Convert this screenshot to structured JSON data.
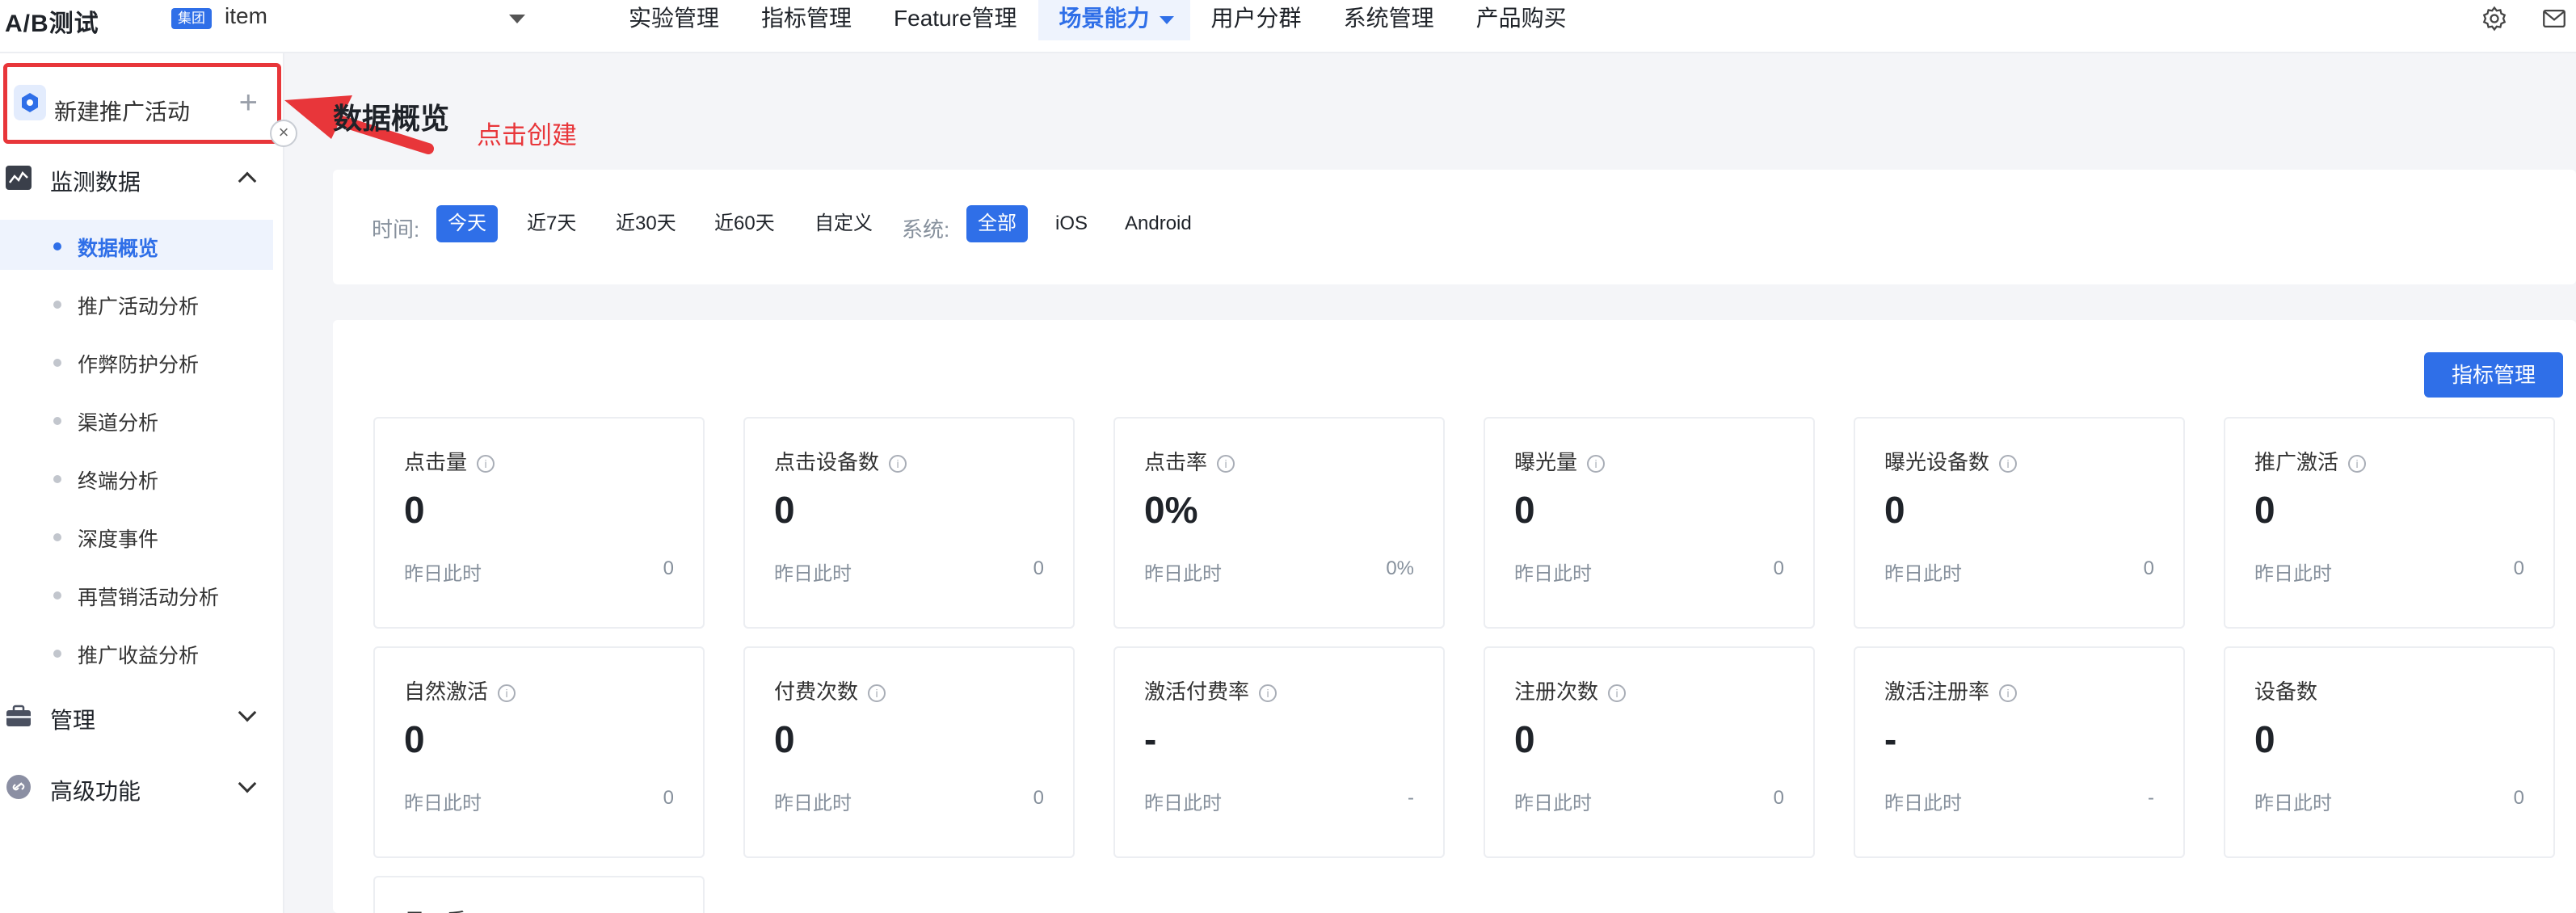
{
  "header": {
    "logo": "A/B测试",
    "badge": "集团",
    "app_name": "item",
    "nav": [
      "实验管理",
      "指标管理",
      "Feature管理",
      "场景能力",
      "用户分群",
      "系统管理",
      "产品购买"
    ],
    "active_nav": "场景能力"
  },
  "sidebar": {
    "new_activity": "新建推广活动",
    "collapse_glyph": "×",
    "groups": [
      {
        "label": "监测数据",
        "expanded": true
      },
      {
        "label": "管理",
        "expanded": false
      },
      {
        "label": "高级功能",
        "expanded": false
      }
    ],
    "sub_items": [
      "数据概览",
      "推广活动分析",
      "作弊防护分析",
      "渠道分析",
      "终端分析",
      "深度事件",
      "再营销活动分析",
      "推广收益分析"
    ],
    "active_sub": "数据概览"
  },
  "annotation": {
    "text": "点击创建",
    "color": "#e8363a"
  },
  "main": {
    "title": "数据概览",
    "filters": {
      "time_label": "时间:",
      "time_options": [
        "今天",
        "近7天",
        "近30天",
        "近60天",
        "自定义"
      ],
      "time_selected": "今天",
      "system_label": "系统:",
      "system_options": [
        "全部",
        "iOS",
        "Android"
      ],
      "system_selected": "全部"
    },
    "metrics_button": "指标管理",
    "compare_label": "昨日此时",
    "metrics": [
      {
        "name": "点击量",
        "info": true,
        "value": "0",
        "compare": "0"
      },
      {
        "name": "点击设备数",
        "info": true,
        "value": "0",
        "compare": "0"
      },
      {
        "name": "点击率",
        "info": true,
        "value": "0%",
        "compare": "0%"
      },
      {
        "name": "曝光量",
        "info": true,
        "value": "0",
        "compare": "0"
      },
      {
        "name": "曝光设备数",
        "info": true,
        "value": "0",
        "compare": "0"
      },
      {
        "name": "推广激活",
        "info": true,
        "value": "0",
        "compare": "0"
      },
      {
        "name": "自然激活",
        "info": true,
        "value": "0",
        "compare": "0"
      },
      {
        "name": "付费次数",
        "info": true,
        "value": "0",
        "compare": "0"
      },
      {
        "name": "激活付费率",
        "info": true,
        "value": "-",
        "compare": "-"
      },
      {
        "name": "注册次数",
        "info": true,
        "value": "0",
        "compare": "0"
      },
      {
        "name": "激活注册率",
        "info": true,
        "value": "-",
        "compare": "-"
      },
      {
        "name": "设备数",
        "info": false,
        "value": "0",
        "compare": "0"
      }
    ],
    "partial_metric_name": "日…香…"
  },
  "colors": {
    "accent": "#2f6fe8",
    "annotation": "#e8363a",
    "muted": "#86909c"
  }
}
